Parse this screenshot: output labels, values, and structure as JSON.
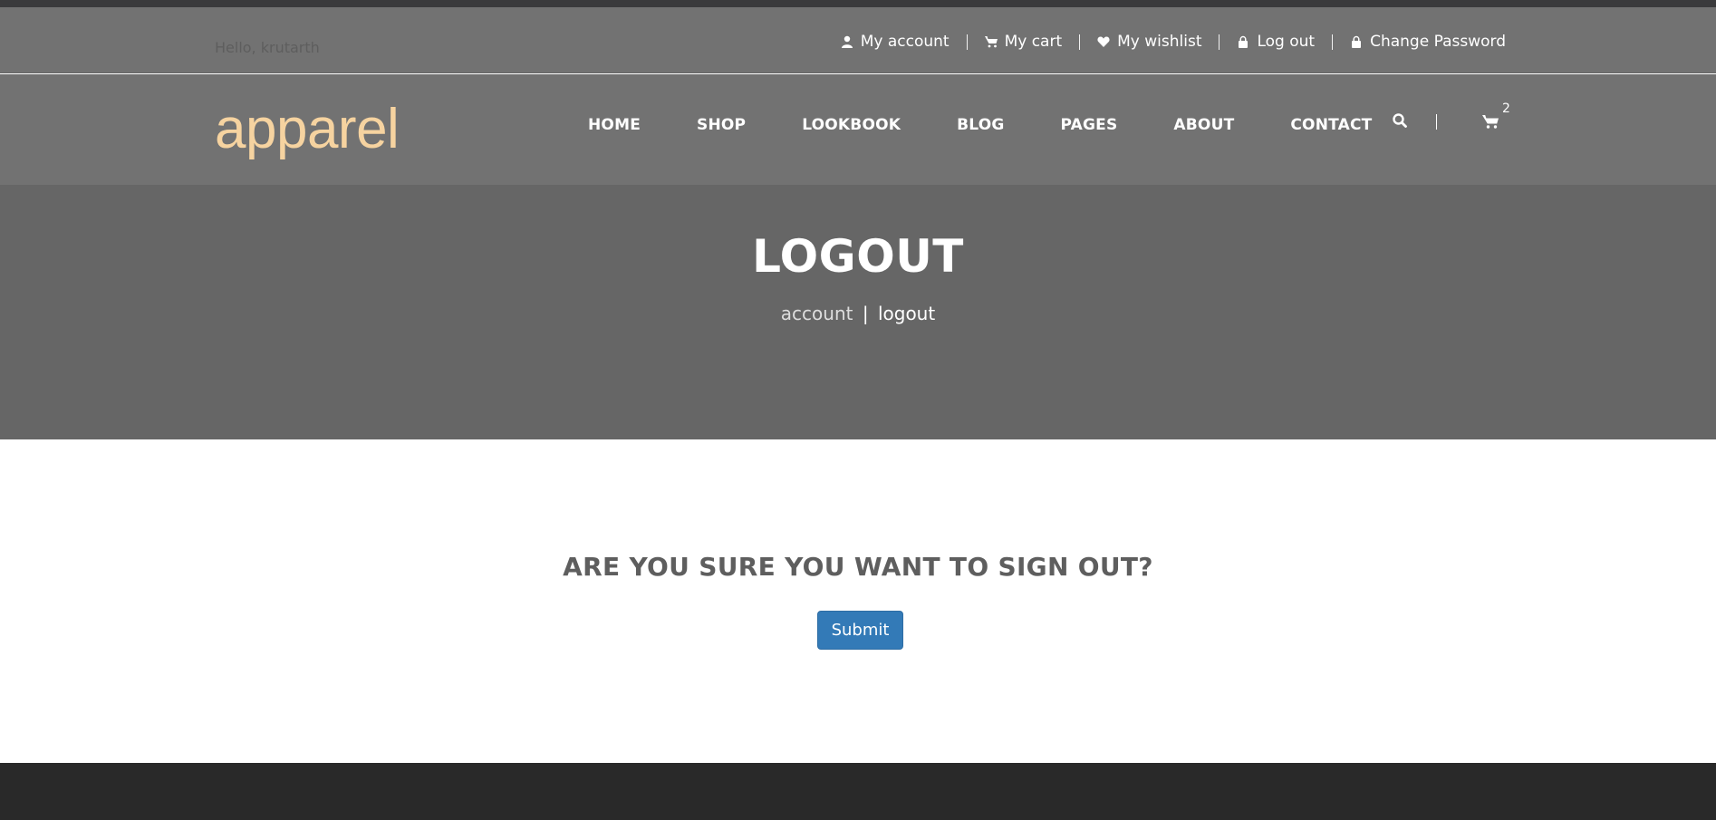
{
  "topbar": {
    "greeting": "Hello, krutarth",
    "links": [
      {
        "label": "My account",
        "icon": "user-icon"
      },
      {
        "label": "My cart",
        "icon": "cart-icon"
      },
      {
        "label": "My wishlist",
        "icon": "heart-icon"
      },
      {
        "label": "Log out",
        "icon": "lock-icon"
      },
      {
        "label": "Change Password",
        "icon": "lock-icon"
      }
    ]
  },
  "navbar": {
    "logo": "apparel",
    "menu": [
      "HOME",
      "SHOP",
      "LOOKBOOK",
      "BLOG",
      "PAGES",
      "ABOUT",
      "CONTACT"
    ],
    "cart_count": "2",
    "icons": [
      "search-icon",
      "cart-icon"
    ]
  },
  "hero": {
    "title": "LOGOUT",
    "breadcrumb": {
      "parent": "account",
      "separator": "|",
      "current": "logout"
    }
  },
  "content": {
    "question": "ARE YOU SURE YOU WANT TO SIGN OUT?",
    "submit_label": "Submit"
  },
  "colors": {
    "logo": "#f6d3a0",
    "header_bg": "#727272",
    "hero_bg": "#666666",
    "button": "#337ab7",
    "footer_bg": "#292929"
  }
}
